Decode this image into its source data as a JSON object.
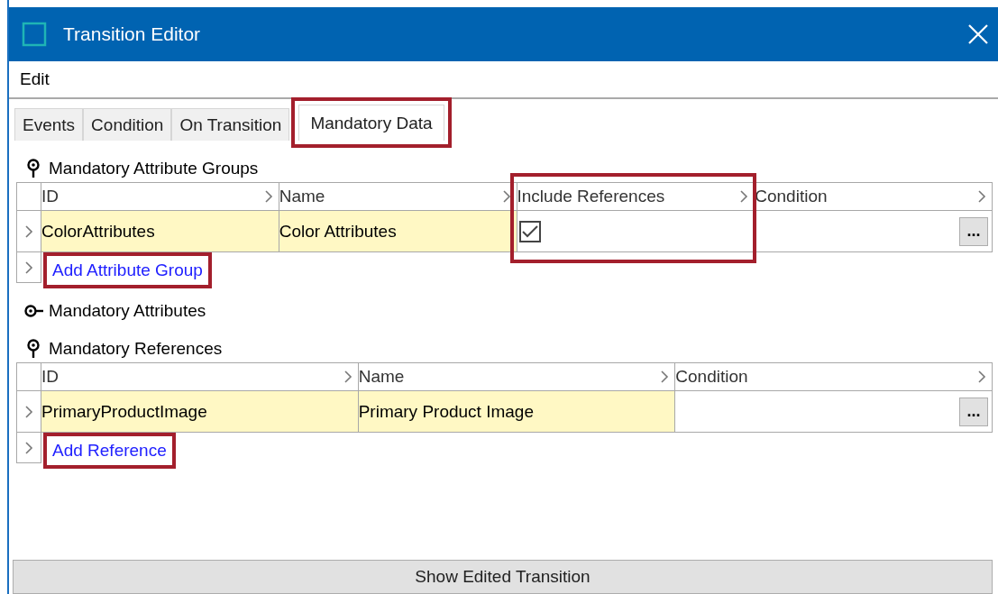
{
  "window": {
    "title": "Transition Editor"
  },
  "menu": [
    "Edit"
  ],
  "tabs": [
    {
      "label": "Events",
      "selected": false,
      "highlighted": false
    },
    {
      "label": "Condition",
      "selected": false,
      "highlighted": false
    },
    {
      "label": "On Transition",
      "selected": false,
      "highlighted": false
    },
    {
      "label": "Mandatory Data",
      "selected": true,
      "highlighted": true
    }
  ],
  "sections": [
    {
      "title": "Mandatory Attribute Groups",
      "expanded": true,
      "columns": [
        {
          "label": "ID",
          "highlighted": false
        },
        {
          "label": "Name",
          "highlighted": false
        },
        {
          "label": "Include References",
          "highlighted": true
        },
        {
          "label": "Condition",
          "highlighted": false
        }
      ],
      "rows": [
        {
          "cells": [
            {
              "kind": "text",
              "text": "ColorAttributes"
            },
            {
              "kind": "text",
              "text": "Color Attributes"
            },
            {
              "kind": "checkbox",
              "checked": true
            },
            {
              "kind": "button",
              "text": "..."
            }
          ]
        }
      ],
      "add_link": {
        "label": "Add Attribute Group",
        "highlighted": true
      }
    },
    {
      "title": "Mandatory Attributes",
      "expanded": false
    },
    {
      "title": "Mandatory References",
      "expanded": true,
      "columns": [
        {
          "label": "ID",
          "highlighted": false
        },
        {
          "label": "Name",
          "highlighted": false
        },
        {
          "label": "Condition",
          "highlighted": false
        }
      ],
      "rows": [
        {
          "cells": [
            {
              "kind": "text",
              "text": "PrimaryProductImage"
            },
            {
              "kind": "text",
              "text": "Primary Product Image"
            },
            {
              "kind": "button",
              "text": "..."
            }
          ]
        }
      ],
      "add_link": {
        "label": "Add Reference",
        "highlighted": true
      }
    }
  ],
  "footer_button": "Show Edited Transition"
}
